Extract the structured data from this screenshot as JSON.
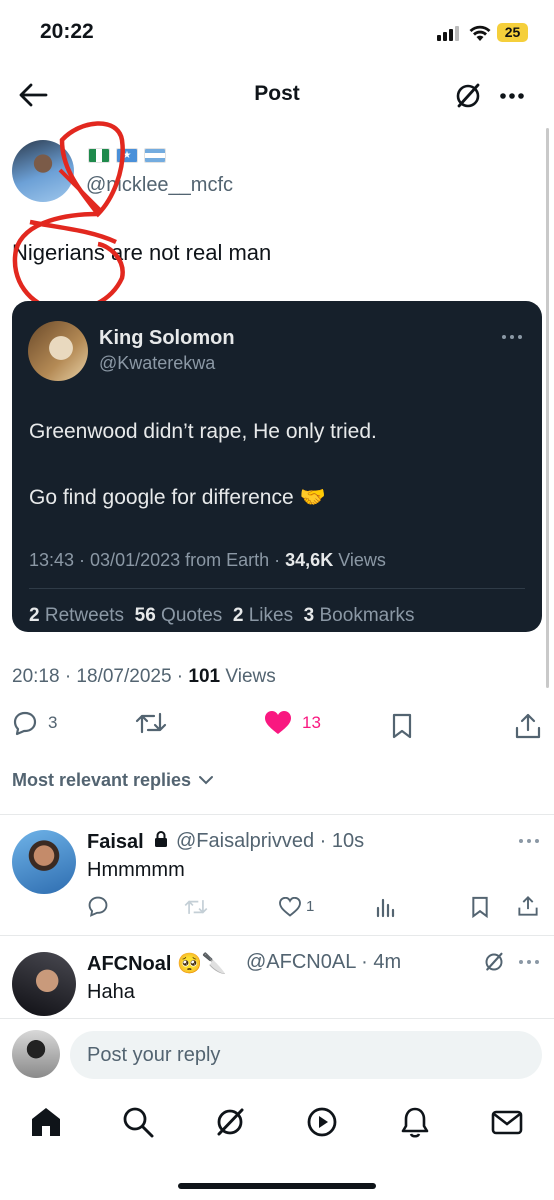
{
  "status_bar": {
    "time": "20:22",
    "battery": "25",
    "battery_color": "#f5cf3b"
  },
  "header": {
    "title": "Post"
  },
  "post": {
    "author_handle": "@nicklee__mcfc",
    "flags": [
      "Nigeria",
      "Somalia",
      "Argentina"
    ],
    "text": "Nigerians are not real man",
    "timestamp": "20:18 · 18/07/2025 · ",
    "views_count": "101",
    "views_label": " Views",
    "replies": "3",
    "likes": "13"
  },
  "quote": {
    "name": "King Solomon",
    "handle": "@Kwaterekwa",
    "line1": "Greenwood didn’t rape, He only tried.",
    "line2": "Go find google for difference 🤝",
    "meta_prefix": "13:43 · 03/01/2023 from Earth · ",
    "views_count": "34,6K",
    "views_label": " Views",
    "retweets": "2",
    "retweets_label": " Retweets  ",
    "quotes": "56",
    "quotes_label": " Quotes  ",
    "likes": "2",
    "likes_label": " Likes  ",
    "bookmarks": "3",
    "bookmarks_label": " Bookmarks"
  },
  "sort_label": "Most relevant replies",
  "replies": [
    {
      "name": "Faisal",
      "handle": "@Faisalprivved · 10s",
      "text": "Hmmmmm",
      "likes": "1"
    },
    {
      "name": "AFCNoal",
      "emoji": "🥺🔪",
      "handle": "@AFCN0AL · 4m",
      "text": "Haha"
    }
  ],
  "compose": {
    "placeholder": "Post your reply"
  },
  "colors": {
    "like": "#f91880",
    "secondary_text": "#536471",
    "quote_bg": "#16202b"
  },
  "nav": [
    "home-icon",
    "search-icon",
    "grok-icon",
    "video-icon",
    "notifications-icon",
    "messages-icon"
  ]
}
